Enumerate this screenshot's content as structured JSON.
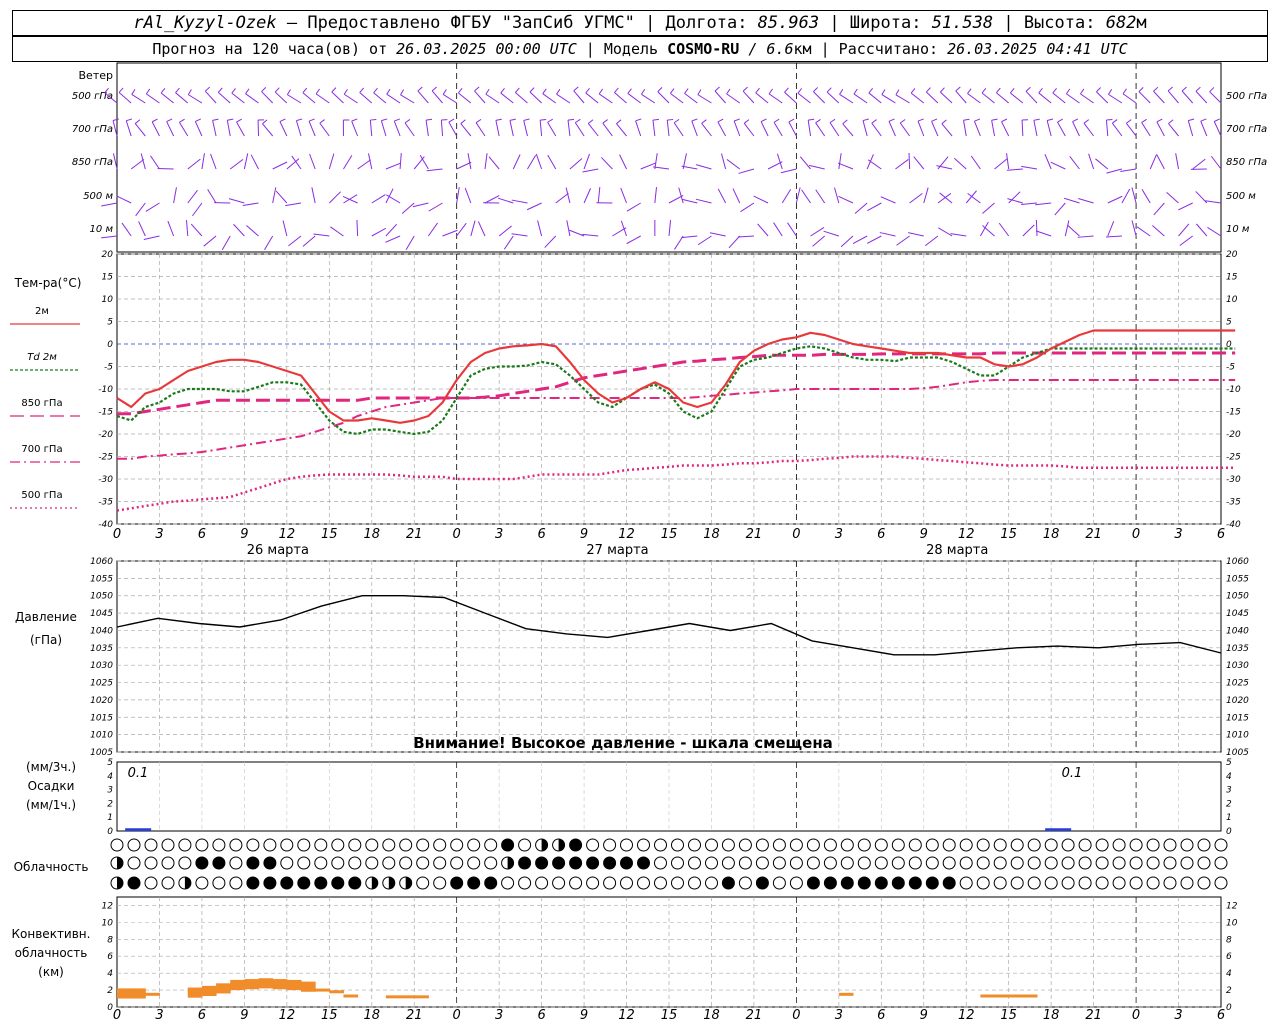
{
  "header": {
    "station": "rAl_Kyzyl-Ozek",
    "provider": " — Предоставлено ФГБУ \"ЗапСиб УГМС\" | Долгота: ",
    "lon": "85.963",
    "lat_label": " | Широта: ",
    "lat": "51.538",
    "alt_label": " | Высота: ",
    "alt": "682",
    "alt_unit": "м",
    "forecast_label": "Прогноз на 120 часа(ов) от ",
    "forecast_time": "26.03.2025 00:00 UTC",
    "model_label": " | Модель ",
    "model": "COSMO-RU",
    "model_res": " / 6.6",
    "model_res_unit": "км",
    "calc_label": " | Рассчитано: ",
    "calc_time": "26.03.2025 04:41 UTC"
  },
  "labels": {
    "wind": "Ветер",
    "wind_levels": [
      "500 гПа",
      "700 гПа",
      "850 гПа",
      "500 м",
      "10 м"
    ],
    "temp_title": "Тем-ра(°С)",
    "legend": [
      {
        "label": "2м",
        "color": "#e8393a"
      },
      {
        "label": "Td 2м",
        "color": "#1a7a1a"
      },
      {
        "label": "850 гПа",
        "color": "#e0267e"
      },
      {
        "label": "700 гПа",
        "color": "#e0267e"
      },
      {
        "label": "500 гПа",
        "color": "#e0267e"
      }
    ],
    "pressure_title": "Давление",
    "pressure_unit": "(гПа)",
    "pressure_warning": "Внимание! Высокое давление - шкала смещена",
    "precip_unit3": "(мм/3ч.)",
    "precip_title": "Осадки",
    "precip_unit1": "(мм/1ч.)",
    "cloud_title": "Облачность",
    "conv_title1": "Конвективн.",
    "conv_title2": "облачность",
    "conv_unit": "(км)",
    "precip_value_1": "0.1",
    "precip_value_2": "0.1"
  },
  "chart_data": {
    "type": "line",
    "x_hour_ticks": [
      "0",
      "3",
      "6",
      "9",
      "12",
      "15",
      "18",
      "21",
      "0",
      "3",
      "6",
      "9",
      "12",
      "15",
      "18",
      "21",
      "0",
      "3",
      "6",
      "9",
      "12",
      "15",
      "18",
      "21",
      "0",
      "3",
      "6"
    ],
    "day_labels": [
      "26 марта",
      "27 марта",
      "28 марта"
    ],
    "temperature": {
      "ylim": [
        -40,
        20
      ],
      "yticks": [
        "20",
        "15",
        "10",
        "5",
        "0",
        "-5",
        "-10",
        "-15",
        "-20",
        "-25",
        "-30",
        "-35",
        "-40"
      ],
      "x_hours": [
        0,
        1,
        2,
        3,
        4,
        5,
        6,
        7,
        8,
        9,
        10,
        11,
        12,
        13,
        14,
        15,
        16,
        17,
        18,
        19,
        20,
        21,
        22,
        23,
        24,
        25,
        26,
        27,
        28,
        29,
        30,
        31,
        32,
        33,
        34,
        35,
        36,
        37,
        38,
        39,
        40,
        41,
        42,
        43,
        44,
        45,
        46,
        47,
        48,
        49,
        50,
        51,
        52,
        53,
        54,
        55,
        56,
        57,
        58,
        59,
        60,
        61,
        62,
        63,
        64,
        65,
        66,
        67,
        68,
        69,
        70,
        71,
        72,
        73,
        74,
        75,
        76,
        77,
        78,
        79
      ],
      "series": [
        {
          "name": "2м",
          "values": [
            -12,
            -14,
            -11,
            -10,
            -8,
            -6,
            -5,
            -4,
            -3.5,
            -3.5,
            -4,
            -5,
            -6,
            -7,
            -11,
            -15,
            -17,
            -17,
            -16.5,
            -17,
            -17.5,
            -17,
            -16,
            -13,
            -8,
            -4,
            -2,
            -1,
            -0.5,
            -0.3,
            0,
            -0.5,
            -4,
            -8,
            -11,
            -13,
            -12,
            -10,
            -8.5,
            -10,
            -13,
            -14,
            -13,
            -9,
            -4,
            -1.5,
            0,
            1,
            1.5,
            2.5,
            2,
            1,
            0,
            -0.5,
            -1,
            -1.5,
            -2,
            -2,
            -2,
            -2.5,
            -3,
            -3,
            -4.5,
            -5,
            -4.5,
            -3,
            -1,
            0.5,
            2,
            3,
            3,
            3,
            3,
            3,
            3,
            3,
            3,
            3,
            3,
            3
          ]
        },
        {
          "name": "Td 2м",
          "values": [
            -16,
            -17,
            -14,
            -13,
            -11,
            -10,
            -10,
            -10,
            -10.5,
            -10.5,
            -9.5,
            -8.5,
            -8.5,
            -9,
            -13,
            -17,
            -19.5,
            -20,
            -19,
            -19,
            -19.5,
            -20,
            -19.5,
            -17,
            -12,
            -7,
            -5.5,
            -5,
            -5,
            -4.8,
            -4,
            -4.5,
            -7,
            -10,
            -13,
            -14,
            -12,
            -10,
            -9,
            -11,
            -15,
            -16.5,
            -15,
            -10,
            -5,
            -3.5,
            -3,
            -2,
            -1,
            -0.5,
            -1,
            -2,
            -3,
            -3.5,
            -3.5,
            -3.8,
            -3,
            -3,
            -3,
            -4,
            -5.5,
            -7,
            -7,
            -5,
            -3,
            -2,
            -1,
            -1,
            -1,
            -1,
            -1,
            -1,
            -1,
            -1,
            -1,
            -1,
            -1,
            -1,
            -1,
            -1
          ]
        },
        {
          "name": "850 гПа",
          "values": [
            -15.5,
            -15.5,
            -15,
            -14.5,
            -14,
            -13.5,
            -13,
            -12.5,
            -12.5,
            -12.5,
            -12.5,
            -12.5,
            -12.5,
            -12.5,
            -12.5,
            -12.5,
            -12.5,
            -12.5,
            -12,
            -12,
            -12,
            -12,
            -12,
            -12,
            -12,
            -12,
            -11.8,
            -11.5,
            -11,
            -10.5,
            -10,
            -9.5,
            -8.5,
            -7.5,
            -7,
            -6.5,
            -6,
            -5.5,
            -5,
            -4.5,
            -4,
            -3.8,
            -3.5,
            -3.3,
            -3,
            -2.8,
            -2.5,
            -2.5,
            -2.5,
            -2.5,
            -2.3,
            -2.3,
            -2.3,
            -2.3,
            -2.2,
            -2.2,
            -2.2,
            -2.2,
            -2.2,
            -2.2,
            -2.2,
            -2.2,
            -2,
            -2,
            -2,
            -2,
            -2,
            -2,
            -2,
            -2,
            -2,
            -2,
            -2,
            -2,
            -2,
            -2,
            -2,
            -2,
            -2,
            -2
          ]
        },
        {
          "name": "700 гПа",
          "values": [
            -25.5,
            -25.5,
            -25,
            -24.8,
            -24.5,
            -24.3,
            -24,
            -23.5,
            -23,
            -22.5,
            -22,
            -21.5,
            -21,
            -20.5,
            -19.5,
            -18.5,
            -17.5,
            -16,
            -15,
            -14,
            -13.5,
            -13,
            -12.5,
            -12,
            -12,
            -12,
            -12,
            -12,
            -12,
            -12,
            -12,
            -12,
            -12,
            -12,
            -12,
            -12,
            -12,
            -12,
            -12,
            -12,
            -12,
            -11.8,
            -11.5,
            -11.3,
            -11,
            -10.8,
            -10.5,
            -10.3,
            -10,
            -10,
            -10,
            -10,
            -10,
            -10,
            -10,
            -10,
            -10,
            -9.8,
            -9.5,
            -9,
            -8.5,
            -8.2,
            -8,
            -8,
            -8,
            -8,
            -8,
            -8,
            -8,
            -8,
            -8,
            -8,
            -8,
            -8,
            -8,
            -8,
            -8,
            -8,
            -8,
            -8
          ]
        },
        {
          "name": "500 гПа",
          "values": [
            -37,
            -36.5,
            -36,
            -35.5,
            -35,
            -34.8,
            -34.5,
            -34.3,
            -34,
            -33,
            -32,
            -31,
            -30,
            -29.5,
            -29.2,
            -29,
            -29,
            -29,
            -29,
            -29,
            -29.2,
            -29.5,
            -29.5,
            -29.5,
            -30,
            -30,
            -30,
            -30,
            -30,
            -29.5,
            -29,
            -29,
            -29,
            -29,
            -29,
            -28.5,
            -28,
            -27.8,
            -27.5,
            -27.3,
            -27,
            -27,
            -27,
            -26.8,
            -26.5,
            -26.5,
            -26.3,
            -26,
            -26,
            -25.8,
            -25.5,
            -25.3,
            -25,
            -25,
            -25,
            -25,
            -25.3,
            -25.5,
            -25.8,
            -26,
            -26.3,
            -26.5,
            -26.8,
            -27,
            -27,
            -27,
            -27,
            -27.2,
            -27.5,
            -27.5,
            -27.5,
            -27.5,
            -27.5,
            -27.5,
            -27.5,
            -27.5,
            -27.5,
            -27.5,
            -27.5,
            -27.5
          ]
        }
      ]
    },
    "pressure": {
      "ylim": [
        1005,
        1060
      ],
      "yticks": [
        "1060",
        "1055",
        "1050",
        "1045",
        "1040",
        "1035",
        "1030",
        "1025",
        "1020",
        "1015",
        "1010",
        "1005"
      ],
      "x_hours": [
        0,
        3,
        6,
        9,
        12,
        15,
        18,
        21,
        24,
        27,
        30,
        33,
        36,
        39,
        42,
        45,
        48,
        51,
        54,
        57,
        60,
        63,
        66,
        69,
        72,
        75,
        78
      ],
      "values": [
        1041,
        1043.5,
        1042,
        1041,
        1043,
        1047,
        1050,
        1050,
        1049.5,
        1045,
        1040.5,
        1039,
        1038,
        1040,
        1042,
        1040,
        1042,
        1037,
        1035,
        1033,
        1033,
        1034,
        1035,
        1035.5,
        1035,
        1036,
        1036.5,
        1033.5
      ]
    },
    "precip": {
      "ylim": [
        0,
        5
      ],
      "yticks": [
        "5",
        "4",
        "3",
        "2",
        "1",
        "0"
      ],
      "bars": [
        {
          "hour": 1,
          "value": 0.1
        },
        {
          "hour": 66,
          "value": 0.1
        }
      ]
    },
    "convective": {
      "ylim": [
        0,
        13
      ],
      "yticks": [
        "12",
        "10",
        "8",
        "6",
        "4",
        "2",
        "0"
      ],
      "bars_km": [
        2.2,
        2.2,
        1.5,
        0,
        0,
        2.3,
        2.5,
        2.8,
        3.2,
        3.3,
        3.4,
        3.3,
        3.2,
        3.0,
        2.0,
        1.8,
        1.3,
        0,
        0,
        1.2,
        1.2,
        1.2,
        0,
        0,
        0,
        0,
        0,
        0,
        0,
        0,
        0,
        0,
        0,
        0,
        0,
        0,
        0,
        0,
        0,
        0,
        0,
        0,
        0,
        0,
        0,
        0,
        0,
        0,
        0,
        0,
        0,
        1.5,
        0,
        0,
        0,
        0,
        0,
        0,
        0,
        0,
        0,
        1.3,
        1.3,
        1.3,
        1.3,
        0,
        0,
        0,
        0,
        0,
        0,
        0,
        0,
        0,
        0,
        0,
        0,
        0,
        0,
        0
      ]
    }
  }
}
